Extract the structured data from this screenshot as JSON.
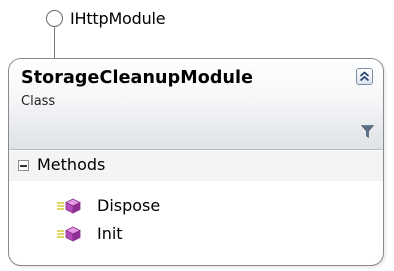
{
  "interface": {
    "name": "IHttpModule"
  },
  "class_shape": {
    "name": "StorageCleanupModule",
    "stereotype": "Class",
    "collapse_icon": "double-chevron-up-icon",
    "filter_icon": "funnel-icon"
  },
  "sections": [
    {
      "label": "Methods",
      "expanded": true,
      "items": [
        {
          "label": "Dispose",
          "icon": "method-icon"
        },
        {
          "label": "Init",
          "icon": "method-icon"
        }
      ]
    }
  ],
  "colors": {
    "border": "#8a8a8a",
    "method_icon": "#b44bb8",
    "header_gradient_bottom": "#dfe2e6"
  }
}
